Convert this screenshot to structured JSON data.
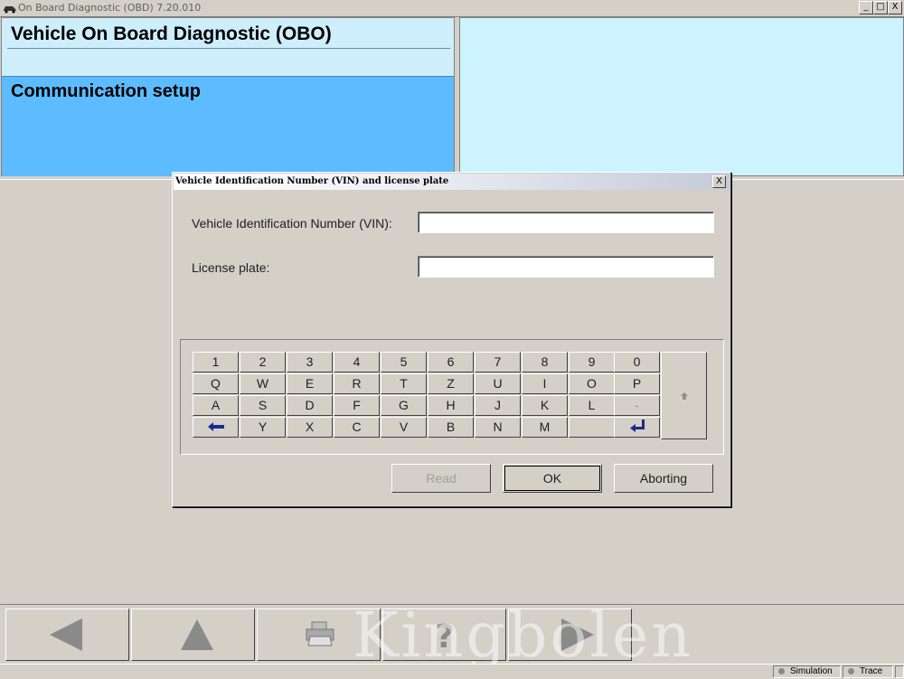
{
  "window": {
    "title": "On Board Diagnostic (OBD) 7.20.010",
    "min_label": "_",
    "max_label": "□",
    "close_label": "X"
  },
  "header": {
    "title": "Vehicle On Board Diagnostic (OBO)",
    "section": "Communication setup"
  },
  "dialog": {
    "title": "Vehicle Identification Number (VIN) and license plate",
    "close_label": "X",
    "vin_label": "Vehicle Identification Number (VIN):",
    "vin_value": "",
    "plate_label": "License plate:",
    "plate_value": "",
    "keyboard": {
      "row1": [
        "1",
        "2",
        "3",
        "4",
        "5",
        "6",
        "7",
        "8",
        "9",
        "0"
      ],
      "row2": [
        "Q",
        "W",
        "E",
        "R",
        "T",
        "Z",
        "U",
        "I",
        "O",
        "P"
      ],
      "row3": [
        "A",
        "S",
        "D",
        "F",
        "G",
        "H",
        "J",
        "K",
        "L",
        "-"
      ],
      "row4": [
        "←",
        "Y",
        "X",
        "C",
        "V",
        "B",
        "N",
        "M",
        "",
        "↵"
      ],
      "shift": "shift-icon"
    },
    "buttons": {
      "read": "Read",
      "ok": "OK",
      "abort": "Aborting"
    }
  },
  "toolbar": {
    "buttons": [
      "back-icon",
      "up-icon",
      "print-icon",
      "help-icon",
      "forward-icon"
    ]
  },
  "watermark": "Kingbolen",
  "status": {
    "simulation": "Simulation",
    "trace": "Trace"
  },
  "colors": {
    "header_light": "#cdeefa",
    "header_blue": "#5cbcff",
    "arrow_key": "#1a2a8c"
  }
}
